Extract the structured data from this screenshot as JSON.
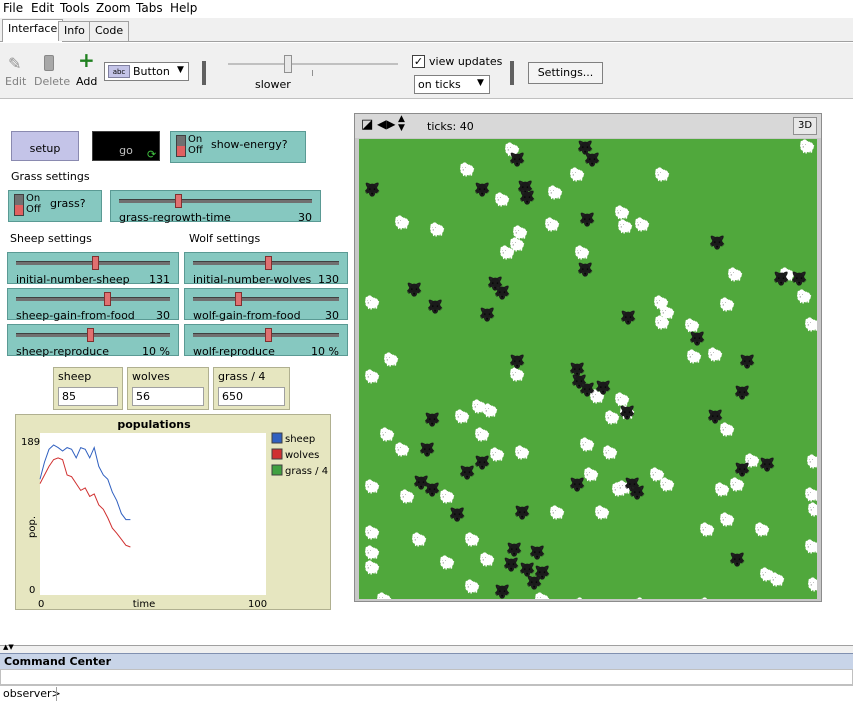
{
  "menubar": {
    "items": [
      "File",
      "Edit",
      "Tools",
      "Zoom",
      "Tabs",
      "Help"
    ]
  },
  "tabs": [
    {
      "label": "Interface",
      "active": true
    },
    {
      "label": "Info",
      "active": false
    },
    {
      "label": "Code",
      "active": false
    }
  ],
  "toolbar": {
    "edit_label": "Edit",
    "delete_label": "Delete",
    "add_label": "Add",
    "widget_type": "Button",
    "speed_label": "slower",
    "view_updates_label": "view updates",
    "view_updates_checked": true,
    "update_mode": "on ticks",
    "settings_label": "Settings..."
  },
  "widgets": {
    "setup_label": "setup",
    "go_label": "go",
    "show_energy": {
      "label": "show-energy?",
      "on": "On",
      "off": "Off"
    },
    "grass_settings_note": "Grass settings",
    "grass_switch": {
      "label": "grass?",
      "on": "On",
      "off": "Off"
    },
    "grass_regrowth": {
      "label": "grass-regrowth-time",
      "value": "30",
      "level": 0.3
    },
    "sheep_settings_note": "Sheep settings",
    "wolf_settings_note": "Wolf settings",
    "initial_number_sheep": {
      "label": "initial-number-sheep",
      "value": "131",
      "level": 0.52
    },
    "sheep_gain_from_food": {
      "label": "sheep-gain-from-food",
      "value": "30",
      "level": 0.6
    },
    "sheep_reproduce": {
      "label": "sheep-reproduce",
      "value": "10 %",
      "level": 0.48
    },
    "initial_number_wolves": {
      "label": "initial-number-wolves",
      "value": "130",
      "level": 0.52
    },
    "wolf_gain_from_food": {
      "label": "wolf-gain-from-food",
      "value": "30",
      "level": 0.3
    },
    "wolf_reproduce": {
      "label": "wolf-reproduce",
      "value": "10 %",
      "level": 0.52
    }
  },
  "monitors": [
    {
      "label": "sheep",
      "value": "85"
    },
    {
      "label": "wolves",
      "value": "56"
    },
    {
      "label": "grass / 4",
      "value": "650"
    }
  ],
  "world": {
    "ticks_label": "ticks: 40",
    "three_d_label": "3D"
  },
  "chart_data": {
    "type": "line",
    "title": "populations",
    "xlabel": "time",
    "ylabel": "pop.",
    "xlim": [
      0,
      100
    ],
    "ylim": [
      0,
      189
    ],
    "x_tick_labels": [
      "0",
      "100"
    ],
    "y_tick_labels": [
      "0",
      "189"
    ],
    "legend_position": "right",
    "series": [
      {
        "name": "sheep",
        "color": "#3060c0",
        "x": [
          0,
          2,
          4,
          6,
          8,
          10,
          12,
          14,
          16,
          18,
          20,
          22,
          24,
          26,
          28,
          30,
          32,
          34,
          36,
          38,
          40
        ],
        "y": [
          135,
          155,
          170,
          175,
          172,
          168,
          172,
          170,
          160,
          172,
          170,
          160,
          172,
          150,
          140,
          135,
          120,
          110,
          95,
          88,
          88
        ]
      },
      {
        "name": "wolves",
        "color": "#d03030",
        "x": [
          0,
          2,
          4,
          6,
          8,
          10,
          12,
          14,
          16,
          18,
          20,
          22,
          24,
          26,
          28,
          30,
          32,
          34,
          36,
          38,
          40
        ],
        "y": [
          130,
          140,
          150,
          158,
          160,
          158,
          140,
          138,
          130,
          122,
          125,
          115,
          118,
          105,
          100,
          90,
          78,
          72,
          65,
          58,
          56
        ]
      },
      {
        "name": "grass / 4",
        "color": "#40a040",
        "x": [],
        "y": []
      }
    ]
  },
  "command_center": {
    "title": "Command Center",
    "prompt": "observer>"
  }
}
